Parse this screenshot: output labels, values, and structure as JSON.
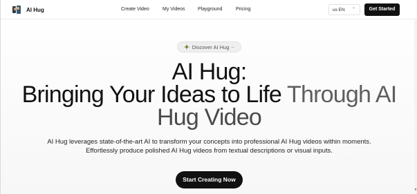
{
  "header": {
    "brand": "AI Hug",
    "nav": [
      "Create Video",
      "My Videos",
      "Playground",
      "Pricing"
    ],
    "language": "us EN",
    "cta": "Get Started"
  },
  "hero": {
    "badge": "Discover AI Hug",
    "badge_arrow": "→",
    "title_line1": "AI Hug:",
    "title_line2_dark": "Bringing Your Ideas to Life ",
    "title_line2_grey": "Through AI",
    "title_line3": "Hug Video",
    "description_line1": "AI Hug leverages state-of-the-art AI to transform your concepts into professional AI Hug videos within moments.",
    "description_line2": "Effortlessly produce polished AI Hug videos from textual descriptions or visual inputs.",
    "cta": "Start Creating Now"
  },
  "icons": {
    "logo": "ai-hug-logo",
    "language_toggle": "chevron-updown-icon",
    "badge": "sparkle-icon"
  },
  "colors": {
    "primary": "#111111",
    "muted_heading": "#5e5e5e",
    "badge_bg": "#efefef"
  }
}
